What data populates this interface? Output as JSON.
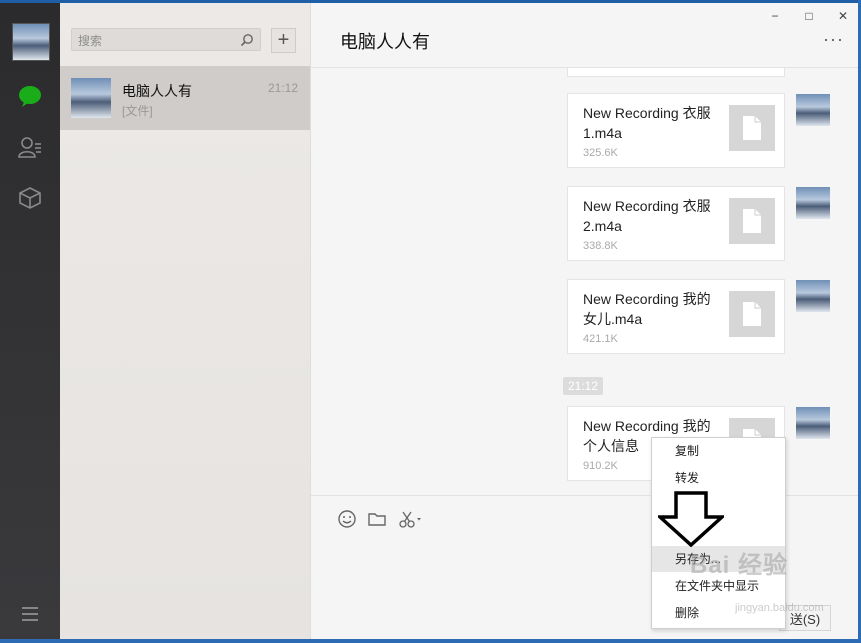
{
  "sidebar": {
    "icons": [
      "chat-icon",
      "contacts-icon",
      "box-icon",
      "menu-icon"
    ]
  },
  "search": {
    "placeholder": "搜索"
  },
  "conversation": {
    "name": "电脑人人有",
    "time": "21:12",
    "preview": "[文件]"
  },
  "chat": {
    "title": "电脑人人有",
    "more": "···",
    "window_controls": [
      "−",
      "□",
      "✕"
    ],
    "timestamp": "21:12",
    "messages": [
      {
        "name": "New Recording 衣服1.m4a",
        "size": "325.6K"
      },
      {
        "name": "New Recording 衣服2.m4a",
        "size": "338.8K"
      },
      {
        "name": "New Recording 我的女儿.m4a",
        "size": "421.1K"
      },
      {
        "name": "New Recording 我的个人信息",
        "size": "910.2K"
      }
    ],
    "send_label": "送(S)"
  },
  "context_menu": {
    "items": [
      "复制",
      "转发",
      "另存为...",
      "在文件夹中显示",
      "删除"
    ]
  },
  "watermark": {
    "text": "Bai 经验",
    "url": "jingyan.baidu.com"
  },
  "colors": {
    "accent": "#1aad19",
    "nav_bg": "#2b2b2d",
    "list_bg": "#ece9e6",
    "selected": "#cfccc9"
  }
}
